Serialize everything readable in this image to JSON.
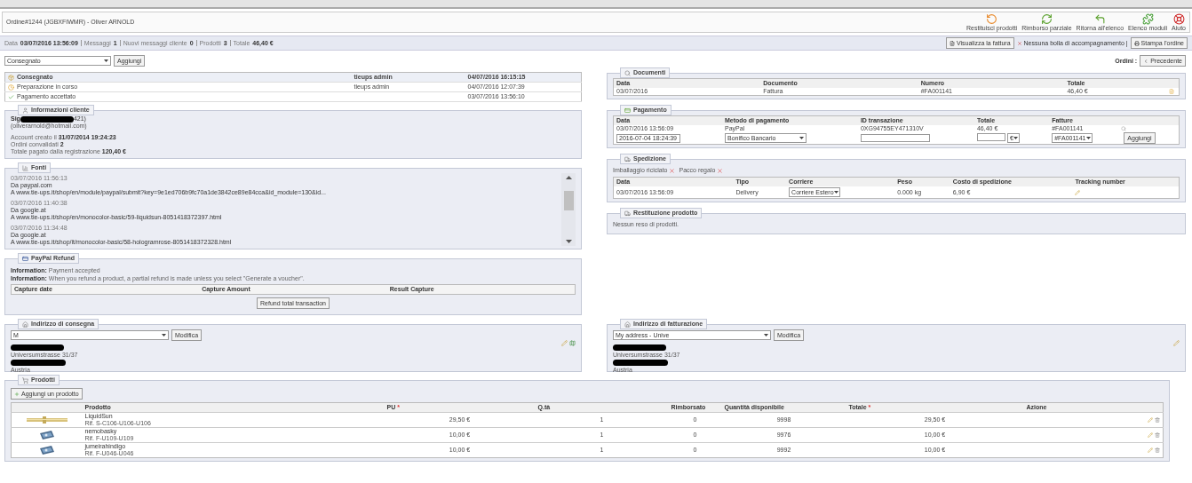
{
  "header": {
    "title": "Ordine#1244 (JGBXFIWMR) - Oliver ARNOLD",
    "toolbar": [
      {
        "label": "Restituisci prodotti"
      },
      {
        "label": "Rimborso parziale"
      },
      {
        "label": "Ritorna all'elenco"
      },
      {
        "label": "Elenco moduli"
      },
      {
        "label": "Aiuto"
      }
    ]
  },
  "summary": [
    {
      "label": "Data",
      "value": "03/07/2016 13:56:09"
    },
    {
      "label": "Messaggi",
      "value": "1"
    },
    {
      "label": "Nuovi messaggi cliente",
      "value": "0"
    },
    {
      "label": "Prodotti",
      "value": "3"
    },
    {
      "label": "Totale",
      "value": "46,40 €"
    }
  ],
  "actions": [
    {
      "kind": "button",
      "label": "Visualizza la fattura"
    },
    {
      "kind": "text",
      "label": "Nessuna bolla di accompagnamento |"
    },
    {
      "kind": "button",
      "label": "Stampa l'ordine"
    }
  ],
  "status_select": {
    "value": "Consegnato",
    "button": "Aggiungi"
  },
  "history": [
    {
      "status": "Consegnato",
      "employee": "tieups admin",
      "date": "04/07/2016 16:15:15",
      "current": true
    },
    {
      "status": "Preparazione in corso",
      "employee": "tieups admin",
      "date": "04/07/2016 12:07:39",
      "current": false
    },
    {
      "status": "Pagamento accettato",
      "date": "03/07/2016 13:56:10",
      "current": false
    }
  ],
  "customer": {
    "legend": "Informazioni cliente",
    "name_start": "Sig",
    "name_end": "421)",
    "email": "(oliverarnold@hotmail.com)",
    "lines": [
      {
        "label": "Account creato il",
        "value": "31/07/2014 19:24:23"
      },
      {
        "label": "Ordini convalidati",
        "value": "2"
      },
      {
        "label": "Totale pagato dalla registrazione",
        "value": "120,40 €"
      }
    ]
  },
  "sources": {
    "legend": "Fonti",
    "entries": [
      {
        "date": "03/07/2016 11:56:13",
        "from": "Da paypal.com",
        "to": "A www.tie-ups.it/shop/en/module/paypal/submit?key=9e1ed706b9fc70a1de3842ce89e84cca&id_module=130&id..."
      },
      {
        "date": "03/07/2016 11:40:38",
        "from": "Da google.at",
        "to": "A www.tie-ups.it/shop/en/monocolor-basic/59-liquidsun-8051418372397.html"
      },
      {
        "date": "03/07/2016 11:34:48",
        "from": "Da google.at",
        "to": "A www.tie-ups.it/shop/it/monocolor-basic/58-hologramrose-8051418372328.html"
      }
    ]
  },
  "paypal_refund": {
    "legend": "PayPal Refund",
    "info": [
      {
        "label": "Information:",
        "text": "Payment accepted"
      },
      {
        "label": "Information:",
        "text": "When you refund a product, a partial refund is made unless you select \"Generate a voucher\"."
      }
    ],
    "columns": [
      "Capture date",
      "Capture Amount",
      "Result Capture"
    ],
    "button": "Refund total transaction"
  },
  "order_nav": {
    "label": "Ordini :",
    "button": "Precedente"
  },
  "documents": {
    "legend": "Documenti",
    "columns": [
      "Data",
      "Documento",
      "Numero",
      "Totale"
    ],
    "rows": [
      {
        "date": "03/07/2016",
        "document": "Fattura",
        "number": "#FA001141",
        "total": "46,40 €"
      }
    ]
  },
  "payment": {
    "legend": "Pagamento",
    "columns": [
      "Data",
      "Metodo di pagamento",
      "ID transazione",
      "Totale",
      "Fatture"
    ],
    "rows": [
      {
        "date": "03/07/2016 13:56:09",
        "method": "PayPal",
        "transaction": "0XG94755EY471310V",
        "total": "46,40 €",
        "invoice": "#FA001141"
      }
    ],
    "form": {
      "date": "2016-07-04 18:24:39",
      "method": "Bonifico Bancario",
      "currency": "€",
      "invoice": "#FA001141",
      "button": "Aggiungi"
    }
  },
  "shipping": {
    "legend": "Spedizione",
    "flags": [
      {
        "label": "Imballaggio riciclato",
        "on": false
      },
      {
        "label": "Pacco regalo",
        "on": false
      }
    ],
    "columns": [
      "Data",
      "Tipo",
      "Corriere",
      "Peso",
      "Costo di spedizione",
      "Tracking number"
    ],
    "rows": [
      {
        "date": "03/07/2016 13:56:09",
        "type": "Delivery",
        "carrier": "Corriere Estero",
        "weight": "0.000 kg",
        "cost": "6,90 €"
      }
    ]
  },
  "returns": {
    "legend": "Restituzione prodotto",
    "text": "Nessun reso di prodotti."
  },
  "delivery_address": {
    "legend": "Indirizzo di consegna",
    "select": "M",
    "button": "Modifica",
    "lines": [
      "Universumstrasse 31/37",
      "Austria"
    ]
  },
  "invoice_address": {
    "legend": "Indirizzo di fatturazione",
    "select": "My address - Unive",
    "button": "Modifica",
    "lines": [
      "Universumstrasse 31/37",
      "Austria"
    ]
  },
  "products": {
    "legend": "Prodotti",
    "add_button": "Aggiungi un prodotto",
    "columns": [
      {
        "label": "Prodotto"
      },
      {
        "label": "PU",
        "mark": "*"
      },
      {
        "label": "Q.tà"
      },
      {
        "label": "Rimborsato"
      },
      {
        "label": "Quantità disponibile"
      },
      {
        "label": "Totale",
        "mark": "*"
      },
      {
        "label": "Azione"
      }
    ],
    "rows": [
      {
        "name": "LiquidSun",
        "ref": "Rif. S-C106-U106-U106",
        "price": "29,50 €",
        "qty": "1",
        "refunded": "0",
        "stock": "9998",
        "total": "29,50 €"
      },
      {
        "name": "nemobasky",
        "ref": "Rif. F-U109-U109",
        "price": "10,00 €",
        "qty": "1",
        "refunded": "0",
        "stock": "9976",
        "total": "10,00 €"
      },
      {
        "name": "jumeirahindigo",
        "ref": "Rif. F-U046-U046",
        "price": "10,00 €",
        "qty": "1",
        "refunded": "0",
        "stock": "9992",
        "total": "10,00 €"
      }
    ]
  }
}
